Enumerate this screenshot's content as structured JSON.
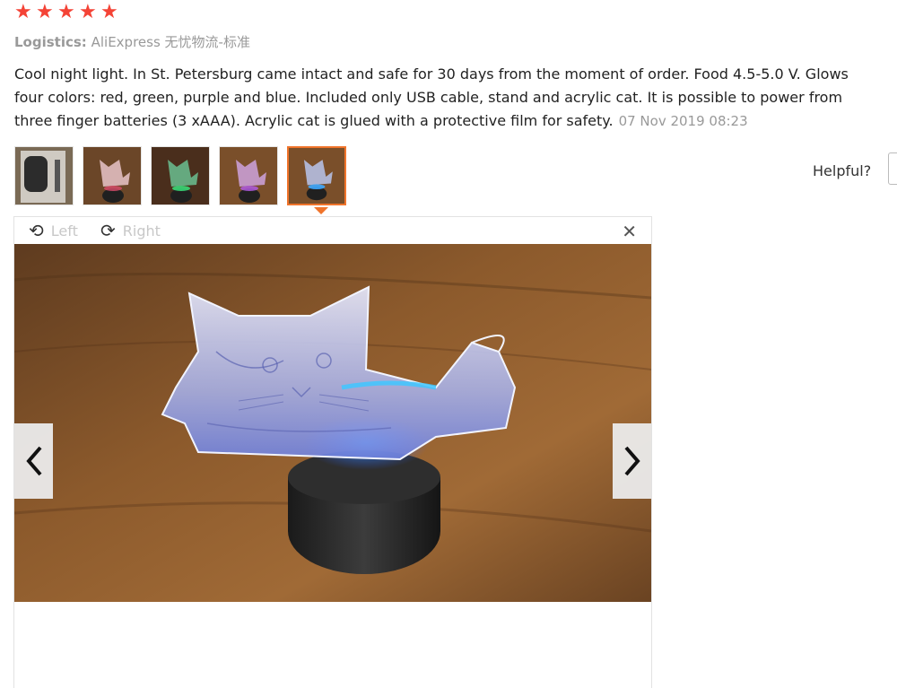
{
  "rating": {
    "stars": 5,
    "color": "#f44336"
  },
  "logistics": {
    "label": "Logistics:",
    "value": "AliExpress 无忧物流-标准"
  },
  "review": {
    "lines": [
      "Cool night light. In St. Petersburg came intact and safe for 30 days from the moment of order. Food 4.5-5.0 V. Glows",
      "four colors: red, green, purple and blue. Included only USB cable, stand and acrylic cat. It is possible to power from",
      "three finger batteries (3 xAAA). Acrylic cat is glued with a protective film for safety."
    ],
    "date": "07 Nov 2019 08:23"
  },
  "thumbnails": [
    {
      "label": "box-photo",
      "active": false
    },
    {
      "label": "red-light-photo",
      "active": false
    },
    {
      "label": "green-light-photo",
      "active": false
    },
    {
      "label": "purple-light-photo",
      "active": false
    },
    {
      "label": "blue-light-photo",
      "active": true
    }
  ],
  "helpful": {
    "label": "Helpful?"
  },
  "viewer": {
    "rotate_left_label": "Left",
    "rotate_right_label": "Right",
    "close_icon": "close-icon",
    "prev_icon": "chevron-left-icon",
    "next_icon": "chevron-right-icon"
  },
  "colors": {
    "accent": "#f0742b"
  }
}
